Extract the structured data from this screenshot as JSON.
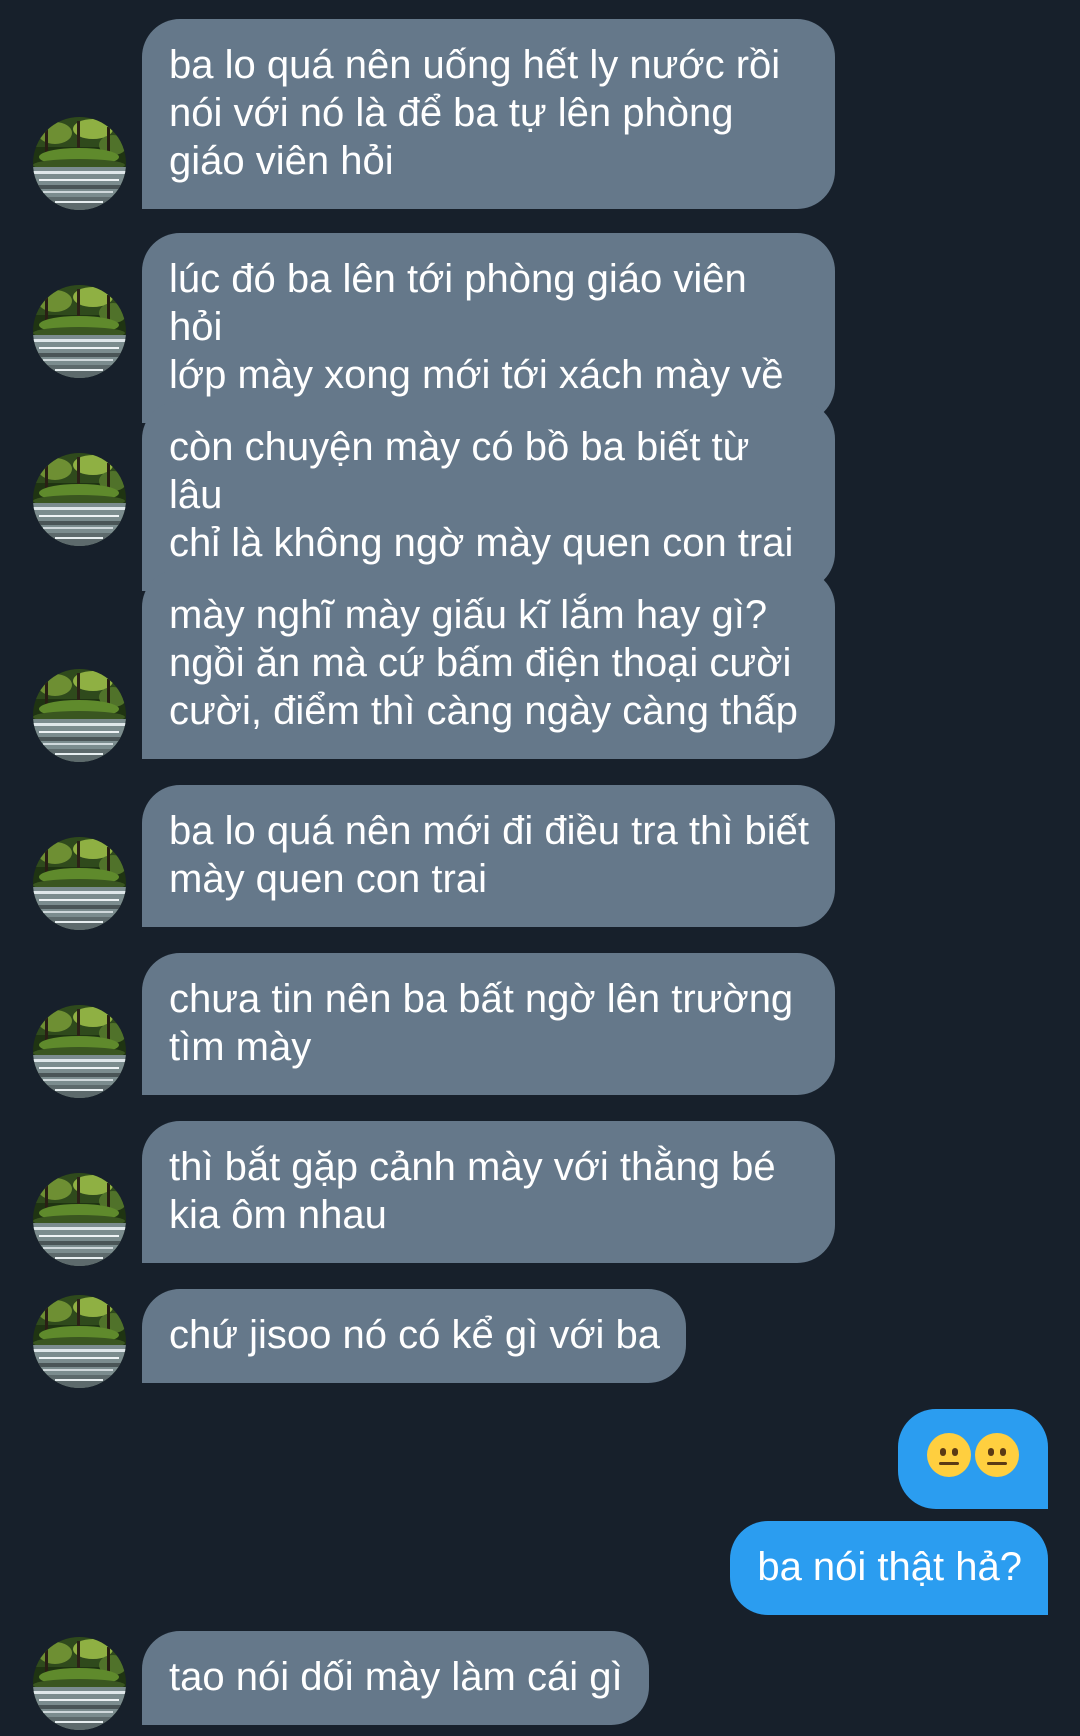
{
  "messages": [
    {
      "sender": "other",
      "text": "ba lo quá nên uống hết ly nước rồi\nnói với nó là để ba tự lên phòng\ngiáo viên hỏi"
    },
    {
      "sender": "other",
      "text": "lúc đó ba lên tới phòng giáo viên hỏi\nlớp mày xong mới tới xách mày về"
    },
    {
      "sender": "other",
      "text": "còn chuyện mày có bồ ba biết từ lâu\nchỉ là không ngờ mày quen con trai"
    },
    {
      "sender": "other",
      "text": "mày nghĩ mày giấu kĩ lắm hay gì?\nngồi ăn mà cứ bấm điện thoại cười\ncười, điểm thì càng ngày càng thấp"
    },
    {
      "sender": "other",
      "text": "ba lo quá nên mới đi điều tra thì biết\nmày quen con trai"
    },
    {
      "sender": "other",
      "text": "chưa tin nên ba bất ngờ lên trường\ntìm mày"
    },
    {
      "sender": "other",
      "text": "thì bắt gặp cảnh mày với thằng bé\nkia ôm nhau"
    },
    {
      "sender": "other",
      "text": "chứ jisoo nó có kể gì với ba"
    },
    {
      "sender": "me",
      "emoji": [
        "neutral-face",
        "neutral-face"
      ]
    },
    {
      "sender": "me",
      "text": "ba nói thật hả?"
    },
    {
      "sender": "other",
      "text": "tao nói dối mày làm cái gì"
    }
  ],
  "colors": {
    "background": "#17202b",
    "incoming_bubble": "#65788a",
    "outgoing_bubble": "#2b9df0",
    "text": "#ffffff"
  },
  "icons": {
    "avatar": "forest-stream-avatar",
    "emoji": "neutral-face-emoji"
  }
}
